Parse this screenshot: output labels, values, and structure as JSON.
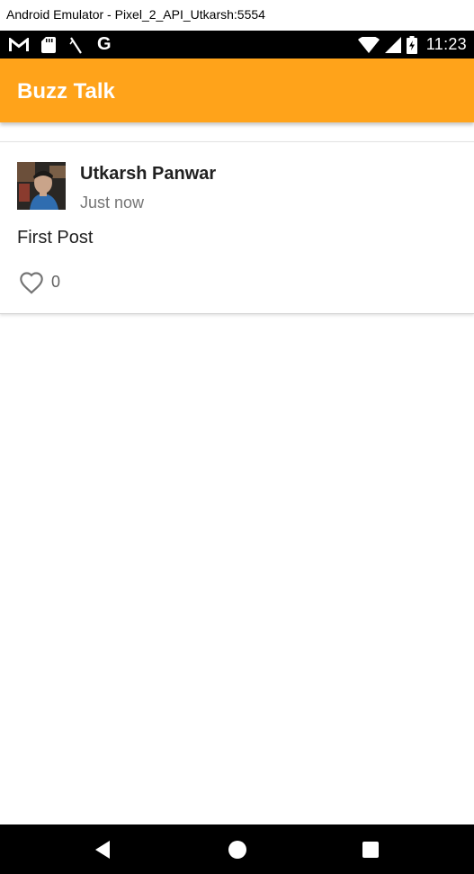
{
  "window": {
    "title": "Android Emulator - Pixel_2_API_Utkarsh:5554"
  },
  "status_bar": {
    "left_icons": [
      "gmail-icon",
      "sd-card-icon",
      "no-signal-slash-icon",
      "google-icon"
    ],
    "google_glyph": "G",
    "right_icons": [
      "wifi-icon",
      "cell-signal-icon",
      "battery-charging-icon"
    ],
    "time": "11:23"
  },
  "app_bar": {
    "title": "Buzz Talk",
    "color": "#ffa31a"
  },
  "post": {
    "author": "Utkarsh Panwar",
    "time": "Just now",
    "text": "First Post",
    "like_icon": "heart-outline-icon",
    "likes": "0"
  },
  "nav_bar": {
    "buttons": [
      "back-icon",
      "home-icon",
      "recents-icon"
    ]
  }
}
